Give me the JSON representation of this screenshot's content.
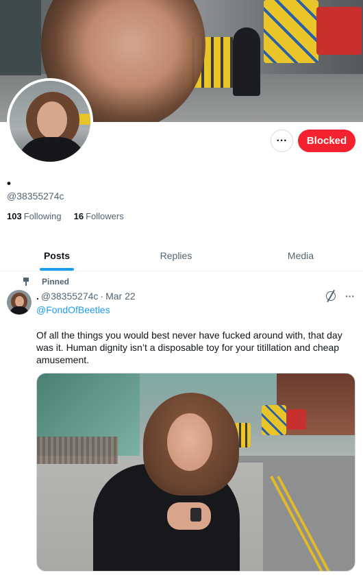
{
  "profile": {
    "display_name": "•",
    "handle": "@38355274c",
    "following_count": "103",
    "following_label": "Following",
    "followers_count": "16",
    "followers_label": "Followers"
  },
  "actions": {
    "more_label": "···",
    "blocked_label": "Blocked"
  },
  "tabs": [
    {
      "label": "Posts",
      "active": true
    },
    {
      "label": "Replies",
      "active": false
    },
    {
      "label": "Media",
      "active": false
    }
  ],
  "tweet": {
    "pinned_label": "Pinned",
    "author_name": ".",
    "author_handle": "@38355274c",
    "separator": "·",
    "date": "Mar 22",
    "mention": "@FondOfBeetles",
    "text": "Of all the things you would best never have fucked around with, that day was it.  Human dignity isn’t a disposable toy for your titillation and cheap amusement.",
    "more_label": "···"
  },
  "colors": {
    "accent": "#1d9bf0",
    "blocked": "#f4212e",
    "muted": "#536471"
  },
  "icons": {
    "pin": "pin-icon",
    "grok": "grok-icon",
    "more": "more-icon"
  }
}
